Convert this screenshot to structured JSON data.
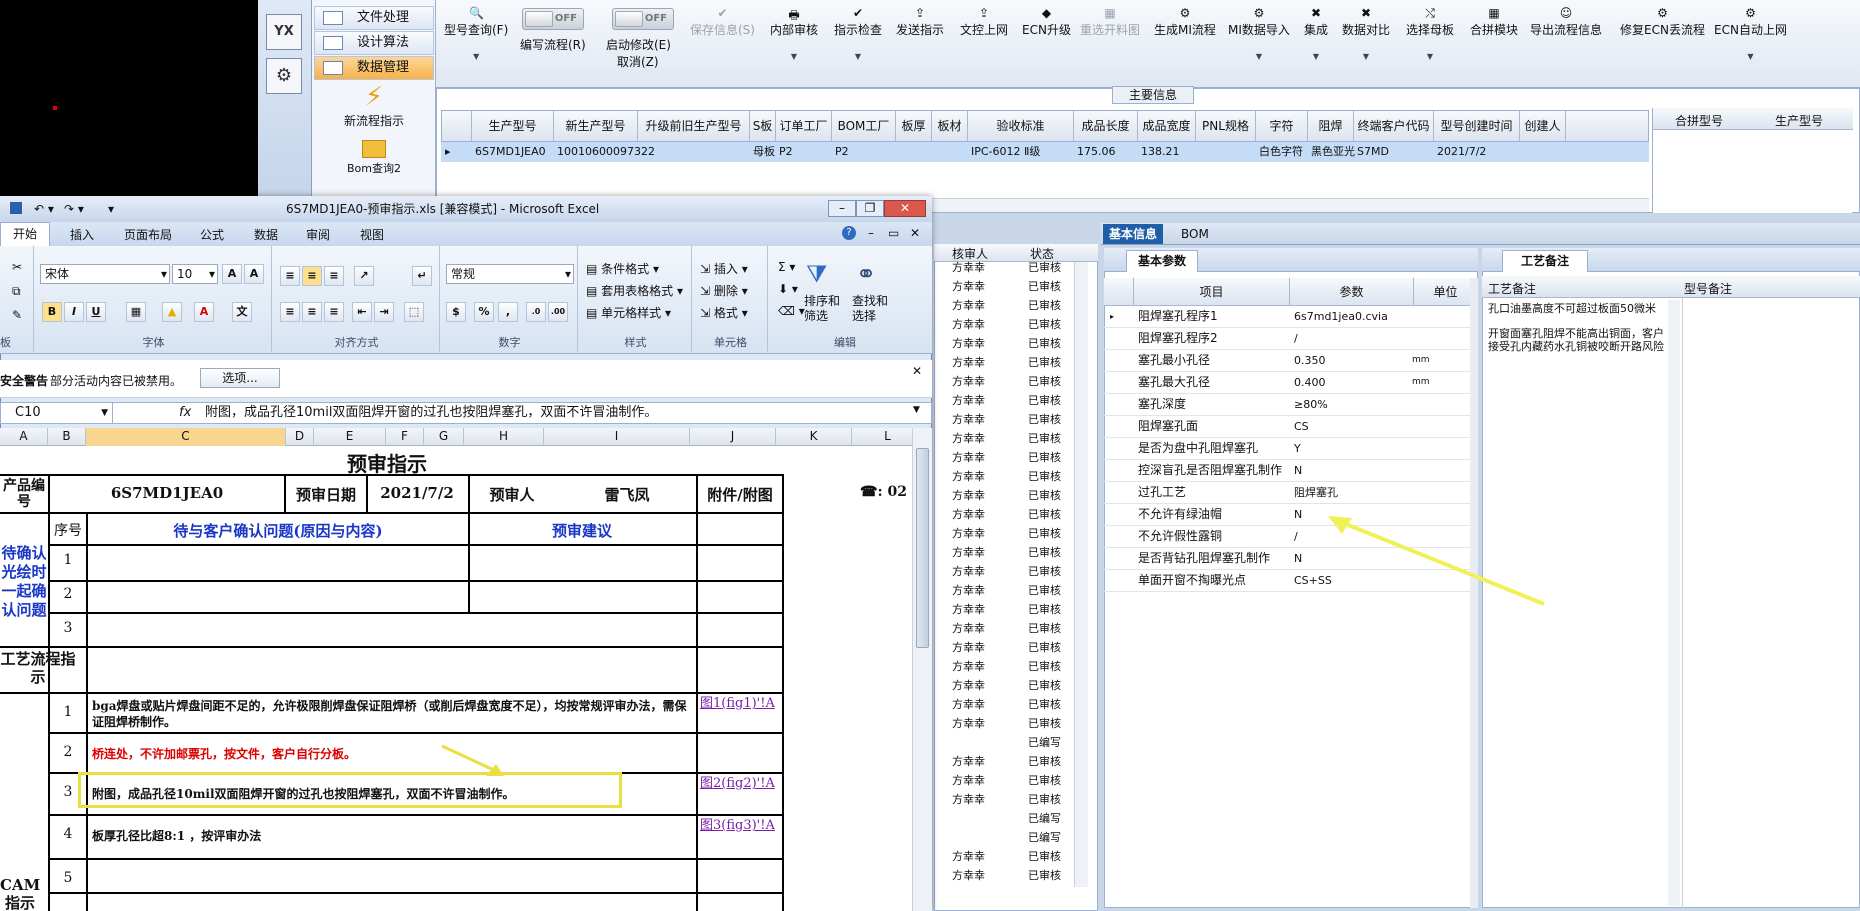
{
  "app_nav": {
    "logo_label": "YX",
    "items": [
      {
        "label": "文件处理"
      },
      {
        "label": "设计算法"
      },
      {
        "label": "数据管理"
      }
    ],
    "launch1": "新流程指示",
    "launch2": "Bom查询2"
  },
  "toolbar": {
    "model_query": "型号查询(F)",
    "write_flow": "编写流程(R)",
    "write_flow_toggle": "OFF",
    "start_modify": "启动修改(E)",
    "start_modify_toggle": "OFF",
    "cancel": "取消(Z)",
    "save_info": "保存信息(S)",
    "internal_review": "内部审核",
    "guide_check": "指示检查",
    "send_guide": "发送指示",
    "upload_doc": "文控上网",
    "ecn_upgrade": "ECN升级",
    "regenerate": "重选开料图",
    "generate_mi": "生成MI流程",
    "mi_import": "MI数据导入",
    "integrate": "集成",
    "data_compare": "数据对比",
    "select_mother": "选择母板",
    "merge_module": "合拼模块",
    "export_flow": "导出流程信息",
    "fix_ecn": "修复ECN丢流程",
    "ecn_auto": "ECN自动上网"
  },
  "main_info": {
    "title": "主要信息",
    "headers": [
      "生产型号",
      "新生产型号",
      "升级前旧生产型号",
      "S板",
      "订单工厂",
      "BOM工厂",
      "板厚",
      "板材",
      "验收标准",
      "成品长度",
      "成品宽度",
      "PNL规格",
      "字符",
      "阻焊",
      "终端客户代码",
      "型号创建时间",
      "创建人"
    ],
    "row": [
      "6S7MD1JEA0",
      "10010600097322",
      "",
      "母板",
      "P2",
      "P2",
      "",
      "",
      "IPC-6012 Ⅱ级",
      "175.06",
      "138.21",
      "",
      "白色字符",
      "黑色亚光",
      "S7MD",
      "2021/7/2",
      ""
    ],
    "right_headers": [
      "合拼型号",
      "生产型号"
    ]
  },
  "right_tabs": [
    "基本信息",
    "BOM"
  ],
  "basic": {
    "title": "基本参数",
    "headers": [
      "项目",
      "参数",
      "单位"
    ],
    "rows": [
      {
        "k": "阻焊塞孔程序1",
        "v": "6s7md1jea0.cvia",
        "u": ""
      },
      {
        "k": "阻焊塞孔程序2",
        "v": "/",
        "u": ""
      },
      {
        "k": "塞孔最小孔径",
        "v": "0.350",
        "u": "mm"
      },
      {
        "k": "塞孔最大孔径",
        "v": "0.400",
        "u": "mm"
      },
      {
        "k": "塞孔深度",
        "v": "≥80%",
        "u": ""
      },
      {
        "k": "阻焊塞孔面",
        "v": "CS",
        "u": ""
      },
      {
        "k": "是否为盘中孔阻焊塞孔",
        "v": "Y",
        "u": ""
      },
      {
        "k": "控深盲孔是否阻焊塞孔制作",
        "v": "N",
        "u": ""
      },
      {
        "k": "过孔工艺",
        "v": "阻焊塞孔",
        "u": ""
      },
      {
        "k": "不允许有绿油帽",
        "v": "N",
        "u": ""
      },
      {
        "k": "不允许假性露铜",
        "v": "/",
        "u": ""
      },
      {
        "k": "是否背钻孔阻焊塞孔制作",
        "v": "N",
        "u": ""
      },
      {
        "k": "单面开窗不掏曝光点",
        "v": "CS+SS",
        "u": ""
      }
    ]
  },
  "craft": {
    "title": "工艺备注",
    "headers": [
      "工艺备注",
      "型号备注"
    ],
    "note1": "孔口油墨高度不可超过板面50微米",
    "note2": "开窗面塞孔阻焊不能高出铜面，客户接受孔内藏药水孔铜被咬断开路风险"
  },
  "review": {
    "headers": [
      "核审人",
      "状态"
    ],
    "rows": [
      [
        "方幸幸",
        "已审核"
      ],
      [
        "方幸幸",
        "已审核"
      ],
      [
        "方幸幸",
        "已审核"
      ],
      [
        "方幸幸",
        "已审核"
      ],
      [
        "方幸幸",
        "已审核"
      ],
      [
        "方幸幸",
        "已审核"
      ],
      [
        "方幸幸",
        "已审核"
      ],
      [
        "方幸幸",
        "已审核"
      ],
      [
        "方幸幸",
        "已审核"
      ],
      [
        "方幸幸",
        "已审核"
      ],
      [
        "方幸幸",
        "已审核"
      ],
      [
        "方幸幸",
        "已审核"
      ],
      [
        "方幸幸",
        "已审核"
      ],
      [
        "方幸幸",
        "已审核"
      ],
      [
        "方幸幸",
        "已审核"
      ],
      [
        "方幸幸",
        "已审核"
      ],
      [
        "方幸幸",
        "已审核"
      ],
      [
        "方幸幸",
        "已审核"
      ],
      [
        "方幸幸",
        "已审核"
      ],
      [
        "方幸幸",
        "已审核"
      ],
      [
        "方幸幸",
        "已审核"
      ],
      [
        "方幸幸",
        "已审核"
      ],
      [
        "方幸幸",
        "已审核"
      ],
      [
        "方幸幸",
        "已审核"
      ],
      [
        "方幸幸",
        "已审核"
      ],
      [
        "",
        "已编写"
      ],
      [
        "方幸幸",
        "已审核"
      ],
      [
        "方幸幸",
        "已审核"
      ],
      [
        "方幸幸",
        "已审核"
      ],
      [
        "",
        "已编写"
      ],
      [
        "",
        "已编写"
      ],
      [
        "方幸幸",
        "已审核"
      ],
      [
        "方幸幸",
        "已审核"
      ]
    ]
  },
  "excel": {
    "title": "6S7MD1JEA0-预审指示.xls  [兼容模式] - Microsoft Excel",
    "tabs": [
      "开始",
      "插入",
      "页面布局",
      "公式",
      "数据",
      "审阅",
      "视图"
    ],
    "font_name": "宋体",
    "font_size": "10",
    "number_format": "常规",
    "groups": [
      "字体",
      "对齐方式",
      "数字",
      "样式",
      "单元格",
      "编辑"
    ],
    "style_items": [
      "条件格式",
      "套用表格格式",
      "单元格样式"
    ],
    "cell_items": [
      "插入",
      "删除",
      "格式"
    ],
    "edit_items": [
      "排序和筛选",
      "查找和选择"
    ],
    "security_label": "安全警告",
    "security_msg": "部分活动内容已被禁用。",
    "options_btn": "选项...",
    "name_box": "C10",
    "formula": "附图，成品孔径10mil双面阻焊开窗的过孔也按阻焊塞孔，双面不许冒油制作。",
    "cols": [
      "A",
      "B",
      "C",
      "D",
      "E",
      "F",
      "G",
      "H",
      "I",
      "J",
      "K",
      "L"
    ],
    "sheet": {
      "heading": "预审指示",
      "product_label": "产品编号",
      "product_no": "6S7MD1JEA0",
      "date_label": "预审日期",
      "date": "2021/7/2",
      "reviewer_label": "预审人",
      "reviewer": "雷飞凤",
      "attach_label": "附件/附图",
      "phone_stub": "☎: 02",
      "seq_label": "序号",
      "issue_label": "待与客户确认问题(原因与内容)",
      "suggest_label": "预审建议",
      "confirm_label": "待确认光绘时一起确认问题",
      "flow_label": "工艺流程指示",
      "cam_label": "CAM指示",
      "rows": [
        {
          "n": "1",
          "t": "bga焊盘或贴片焊盘间距不足的，允许极限削焊盘保证阻焊桥（或削后焊盘宽度不足），均按常规评审办法，需保证阻焊桥制作。",
          "link": "图1(fig1)'!A"
        },
        {
          "n": "2",
          "t": "桥连处，不许加邮票孔，按文件，客户自行分板。",
          "link": ""
        },
        {
          "n": "3",
          "t": "附图，成品孔径10mil双面阻焊开窗的过孔也按阻焊塞孔，双面不许冒油制作。",
          "link": "图2(fig2)'!A"
        },
        {
          "n": "4",
          "t": "板厚孔径比超8:1 ，按评审办法",
          "link": "图3(fig3)'!A"
        },
        {
          "n": "5",
          "t": "",
          "link": ""
        }
      ]
    }
  }
}
